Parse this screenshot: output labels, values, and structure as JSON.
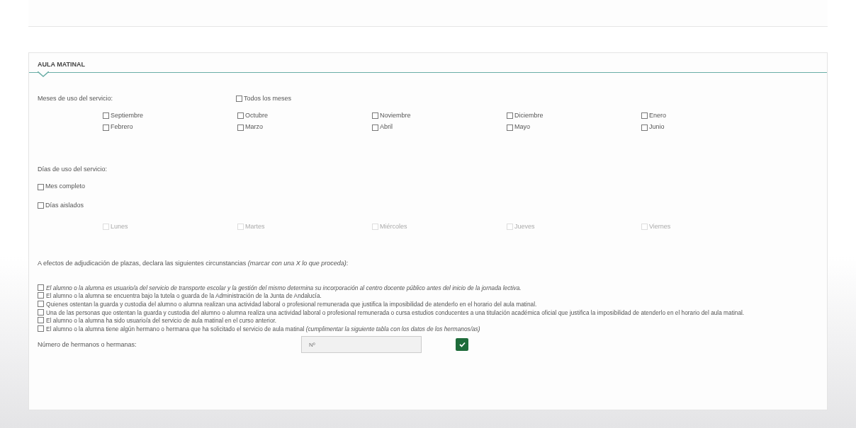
{
  "section_title": "AULA MATINAL",
  "months_label": "Meses de uso del servicio:",
  "all_months": {
    "label": "Todos los meses",
    "checked": false
  },
  "months": [
    {
      "label": "Septiembre",
      "checked": false
    },
    {
      "label": "Octubre",
      "checked": false
    },
    {
      "label": "Noviembre",
      "checked": false
    },
    {
      "label": "Diciembre",
      "checked": false
    },
    {
      "label": "Enero",
      "checked": false
    },
    {
      "label": "Febrero",
      "checked": false
    },
    {
      "label": "Marzo",
      "checked": false
    },
    {
      "label": "Abril",
      "checked": false
    },
    {
      "label": "Mayo",
      "checked": false
    },
    {
      "label": "Junio",
      "checked": false
    }
  ],
  "days_label": "Días de uso del servicio:",
  "day_modes": [
    {
      "label": "Mes completo",
      "checked": false
    },
    {
      "label": "Días aislados",
      "checked": false
    }
  ],
  "days": [
    {
      "label": "Lunes",
      "checked": false,
      "disabled": true
    },
    {
      "label": "Martes",
      "checked": false,
      "disabled": true
    },
    {
      "label": "Miércoles",
      "checked": false,
      "disabled": true
    },
    {
      "label": "Jueves",
      "checked": false,
      "disabled": true
    },
    {
      "label": "Viernes",
      "checked": false,
      "disabled": true
    }
  ],
  "declaration_intro": "A efectos de adjudicación de plazas, declara las siguientes circunstancias *(marcar con una X lo que proceda)*:",
  "declarations": [
    {
      "text": "*El alumno o la alumna es usuario/a del servicio de transporte escolar y la gestión del mismo determina su incorporación al centro docente público antes del inicio de la jornada lectiva.*",
      "checked": false
    },
    {
      "text": "El alumno o la alumna se encuentra bajo la tutela o guarda de la Administración de la Junta de Andalucía.",
      "checked": false
    },
    {
      "text": "Quienes ostentan la guarda y custodia del alumno o alumna realizan una actividad laboral o profesional remunerada que justifica la imposibilidad de atenderlo en el horario del aula matinal.",
      "checked": false
    },
    {
      "text": "Una de las personas que ostentan la guarda y custodia del alumno o alumna realiza una actividad laboral o profesional remunerada o cursa estudios conducentes a una titulación académica oficial que justifica la imposibilidad de atenderlo en el horario del aula matinal.",
      "checked": false
    },
    {
      "text": "El alumno o la alumna ha sido usuario/a del servicio de aula matinal en el curso anterior.",
      "checked": false
    },
    {
      "text": "El alumno o la alumna tiene algún hermano o hermana que ha solicitado el servicio de aula matinal *(cumplimentar la siguiente tabla con los datos de los hermanos/as)*",
      "checked": false
    }
  ],
  "siblings": {
    "label": "Número de hermanos o hermanas:",
    "placeholder": "Nº"
  }
}
